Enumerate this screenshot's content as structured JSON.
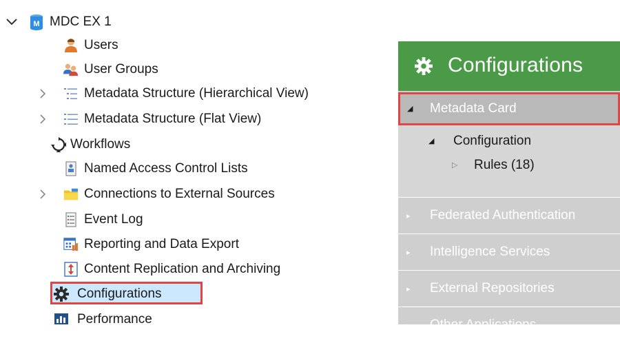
{
  "tree": {
    "root_label": "MDC EX 1",
    "items": [
      {
        "label": "Users",
        "icon": "user-icon"
      },
      {
        "label": "User Groups",
        "icon": "user-group-icon"
      },
      {
        "label": "Metadata Structure (Hierarchical View)",
        "icon": "hierarchical-list-icon"
      },
      {
        "label": "Metadata Structure (Flat View)",
        "icon": "flat-list-icon"
      },
      {
        "label": "Workflows",
        "icon": "workflow-icon"
      },
      {
        "label": "Named Access Control Lists",
        "icon": "access-list-icon"
      },
      {
        "label": "Connections to External Sources",
        "icon": "folder-connection-icon"
      },
      {
        "label": "Event Log",
        "icon": "event-log-icon"
      },
      {
        "label": "Reporting and Data Export",
        "icon": "reporting-icon"
      },
      {
        "label": "Content Replication and Archiving",
        "icon": "replication-icon"
      },
      {
        "label": "Configurations",
        "icon": "gear-icon"
      },
      {
        "label": "Performance",
        "icon": "performance-icon"
      }
    ]
  },
  "panel": {
    "title": "Configurations",
    "metadata_card": "Metadata Card",
    "configuration": "Configuration",
    "rules": "Rules (18)",
    "sections": [
      "Federated Authentication",
      "Intelligence Services",
      "External Repositories",
      "Other Applications"
    ]
  },
  "colors": {
    "header_green": "#4a9a47",
    "highlight_red": "#e04545",
    "selection_blue": "#cce8ff",
    "panel_gray": "#cfcfcf"
  }
}
